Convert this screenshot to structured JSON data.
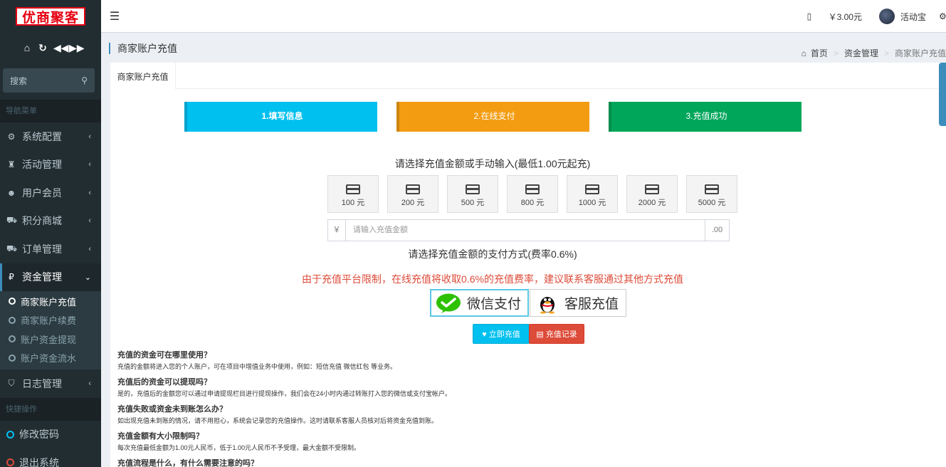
{
  "brand": {
    "logo_text": "优商聚客"
  },
  "sidebar": {
    "search_placeholder": "搜索",
    "nav_header": "导航菜单",
    "menu": [
      {
        "label": "系统配置",
        "icon": "gear-icon"
      },
      {
        "label": "活动管理",
        "icon": "trophy-icon"
      },
      {
        "label": "用户会员",
        "icon": "users-icon"
      },
      {
        "label": "积分商城",
        "icon": "cart-icon"
      },
      {
        "label": "订单管理",
        "icon": "truck-icon"
      },
      {
        "label": "资金管理",
        "icon": "yen-icon"
      }
    ],
    "submenu": [
      {
        "label": "商家账户充值"
      },
      {
        "label": "商家账户续费"
      },
      {
        "label": "账户资金提现"
      },
      {
        "label": "账户资金流水"
      }
    ],
    "log_menu": {
      "label": "日志管理",
      "icon": "shield-icon"
    },
    "quick_header": "快捷操作",
    "quick": [
      {
        "label": "修改密码"
      },
      {
        "label": "退出系统"
      }
    ]
  },
  "navbar": {
    "balance": "￥3.00元",
    "username": "活动宝"
  },
  "page": {
    "title": "商家账户充值",
    "breadcrumb": [
      "首页",
      "资金管理",
      "商家账户充值"
    ],
    "tab": "商家账户充值"
  },
  "steps": [
    "1.填写信息",
    "2.在线支付",
    "3.充值成功"
  ],
  "recharge": {
    "amount_title": "请选择充值金额或手动输入(最低1.00元起充)",
    "amounts": [
      "100 元",
      "200 元",
      "500 元",
      "800 元",
      "1000 元",
      "2000 元",
      "5000 元"
    ],
    "currency": "￥",
    "input_placeholder": "请输入充值金额",
    "decimal": ".00",
    "pay_title": "请选择充值金额的支付方式(费率0.6%)",
    "warning": "由于充值平台限制，在线充值将收取0.6%的充值费率，建议联系客服通过其他方式充值",
    "pay_wechat": "微信支付",
    "pay_service": "客服充值",
    "btn_charge": "立即充值",
    "btn_record": "充值记录"
  },
  "faq": [
    {
      "q": "充值的资金可在哪里使用？",
      "a": "充值的金额将进入您的个人账户，可在项目中增值业务中使用，例如：短信充值 微信红包 等业务。"
    },
    {
      "q": "充值后的资金可以提现吗？",
      "a": "是的，充值后的金额您可以通过申请提现栏目进行提现操作，我们会在24小时内通过转账打入您的微信或支付宝帐户。"
    },
    {
      "q": "充值失败或资金未到账怎么办？",
      "a": "如出现充值未到账的情况，请不用担心，系统会记录您的充值操作。这时请联系客服人员核对后将资金充值到账。"
    },
    {
      "q": "充值金额有大小限制吗？",
      "a": "每次充值最低金额为1.00元人民币，低于1.00元人民币不予受理，最大金额不受限制。"
    },
    {
      "q": "充值流程是什么，有什么需要注意的吗？",
      "a": ""
    }
  ],
  "colors": {
    "step1": "#00c0ef",
    "step2": "#f39c12",
    "step3": "#00a65a",
    "warning": "#dd4b39"
  }
}
